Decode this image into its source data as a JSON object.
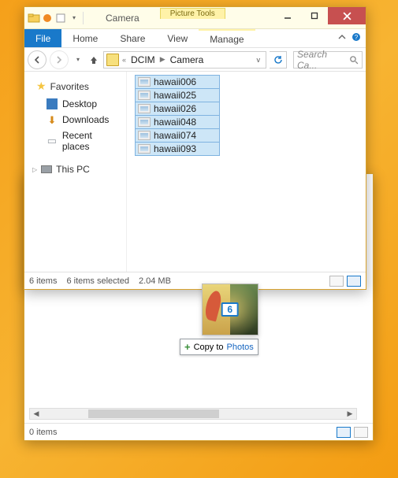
{
  "colors": {
    "accent": "#1979ca",
    "highlight": "#cde6f7",
    "contextTab": "#fff2a8"
  },
  "win_a": {
    "title": "Camera",
    "context_tab_header": "Picture Tools",
    "ribbon": {
      "file": "File",
      "home": "Home",
      "share": "Share",
      "view": "View",
      "manage": "Manage"
    },
    "address": {
      "ellipsis": "«",
      "crumbs": [
        "DCIM",
        "Camera"
      ]
    },
    "search_placeholder": "Search Ca...",
    "nav": {
      "favorites": "Favorites",
      "items": [
        {
          "icon": "desktop",
          "label": "Desktop"
        },
        {
          "icon": "downloads",
          "label": "Downloads"
        },
        {
          "icon": "recent",
          "label": "Recent places"
        }
      ],
      "thispc": "This PC"
    },
    "files": [
      "hawaii006",
      "hawaii025",
      "hawaii026",
      "hawaii048",
      "hawaii074",
      "hawaii093"
    ],
    "status": {
      "count": "6 items",
      "selected": "6 items selected",
      "size": "2.04 MB"
    }
  },
  "win_b": {
    "status_count": "0 items"
  },
  "drag": {
    "count": "6",
    "tooltip_prefix": "Copy to ",
    "tooltip_target": "Photos"
  }
}
